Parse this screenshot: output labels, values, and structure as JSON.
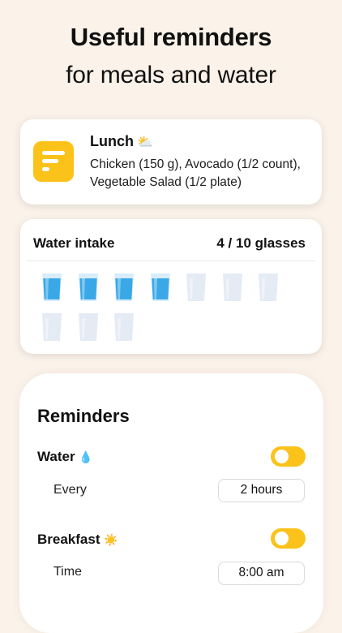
{
  "header": {
    "title": "Useful reminders",
    "subtitle": "for meals and water"
  },
  "meal_card": {
    "title": "Lunch",
    "weather_icon": "⛅",
    "description": "Chicken (150 g), Avocado (1/2 count), Vegetable Salad (1/2 plate)",
    "accent": "#fbc21a"
  },
  "water_card": {
    "title": "Water intake",
    "count_label": "4 / 10 glasses",
    "filled": 4,
    "total": 10,
    "filled_color": "#3aa8e6",
    "empty_color": "#e4ebf4"
  },
  "reminders": {
    "title": "Reminders",
    "water": {
      "label": "Water",
      "emoji": "💧",
      "enabled": true,
      "sub_label": "Every",
      "value": "2 hours"
    },
    "breakfast": {
      "label": "Breakfast",
      "emoji": "☀️",
      "enabled": true,
      "sub_label": "Time",
      "value": "8:00 am"
    },
    "toggle_color": "#fbc21a"
  }
}
